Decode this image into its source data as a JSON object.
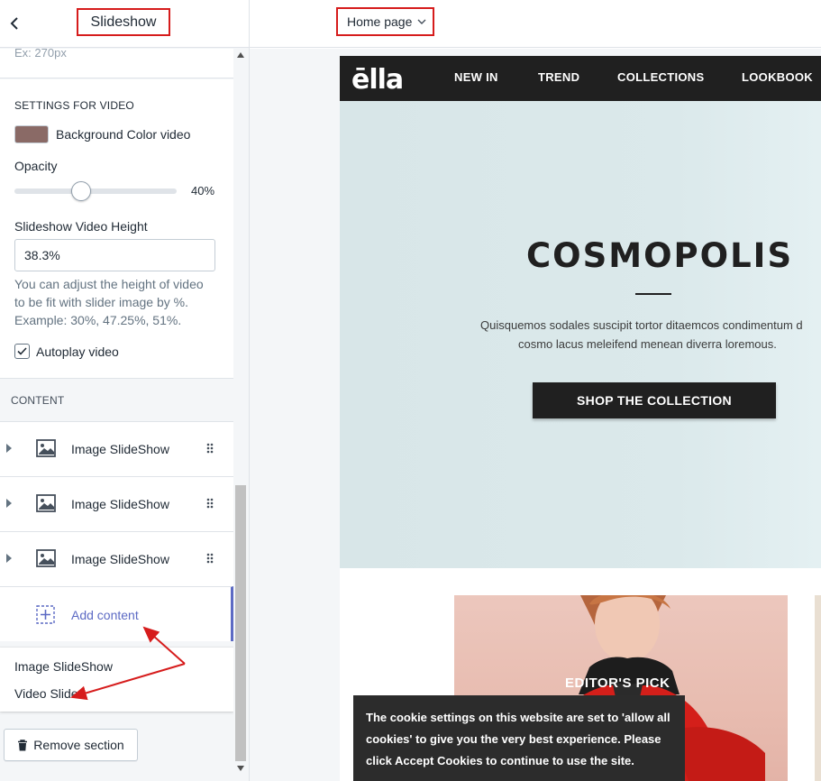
{
  "header": {
    "title": "Slideshow",
    "back_icon": "chevron-left-icon"
  },
  "top_bar": {
    "page_select": "Home page"
  },
  "settings": {
    "previous_hint": "Ex: 270px",
    "video_section_title": "SETTINGS FOR VIDEO",
    "bg_color_label": "Background Color video",
    "bg_color_value": "#8a6a66",
    "opacity_label": "Opacity",
    "opacity_value": "40%",
    "opacity_fraction": 0.4,
    "height_label": "Slideshow Video Height",
    "height_value": "38.3%",
    "height_help_1": "You can adjust the height of video",
    "height_help_2": "to be fit with slider image by %.",
    "height_help_3": "Example: 30%, 47.25%, 51%.",
    "autoplay_label": "Autoplay video",
    "autoplay_checked": true
  },
  "content": {
    "section_title": "CONTENT",
    "blocks": [
      {
        "label": "Image SlideShow"
      },
      {
        "label": "Image SlideShow"
      },
      {
        "label": "Image SlideShow"
      }
    ],
    "add_label": "Add content",
    "popover_options": [
      "Image SlideShow",
      "Video Slider"
    ],
    "remove_label": "Remove section"
  },
  "store": {
    "logo": "ēlla",
    "nav": [
      "NEW IN",
      "TREND",
      "COLLECTIONS",
      "LOOKBOOK"
    ],
    "hero_title": "COSMOPOLIS",
    "hero_sub_1": "Quisquemos sodales suscipit tortor ditaemcos condimentum d",
    "hero_sub_2": "cosmo lacus meleifend menean diverra loremous.",
    "hero_button": "SHOP THE COLLECTION",
    "editor_label": "EDITOR'S PICK"
  },
  "cookie": {
    "line_1": "The cookie settings on this website are set to 'allow all",
    "line_2": "cookies' to give you the very best experience. Please",
    "line_3": "click Accept Cookies to continue to use the site."
  },
  "colors": {
    "highlight_red": "#d61c1c",
    "accent": "#5c6ac4",
    "store_dark": "#202020",
    "hero_bg": "#dbe9eb"
  }
}
